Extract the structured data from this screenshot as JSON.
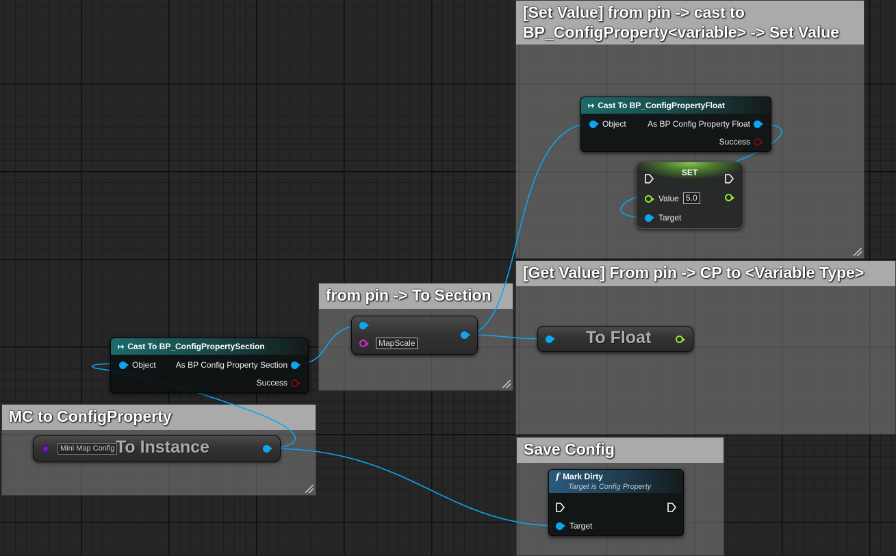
{
  "comments": {
    "set_value": {
      "title_line1": "[Set Value] from pin -> cast to",
      "title_line2": "BP_ConfigProperty<variable> -> Set Value"
    },
    "get_value": {
      "title": "[Get Value] From pin -> CP to <Variable Type>"
    },
    "from_pin": {
      "title": "from pin -> To Section"
    },
    "mc_config": {
      "title": "MC to ConfigProperty"
    },
    "save_config": {
      "title": "Save Config"
    }
  },
  "nodes": {
    "cast_float": {
      "title": "Cast To BP_ConfigPropertyFloat",
      "in_object": "Object",
      "out_as": "As BP Config Property Float",
      "out_success": "Success"
    },
    "set_node": {
      "title": "SET",
      "value_label": "Value",
      "value": "5.0",
      "target_label": "Target"
    },
    "cast_section": {
      "title": "Cast To BP_ConfigPropertySection",
      "in_object": "Object",
      "out_as": "As BP Config Property Section",
      "out_success": "Success"
    },
    "get_section_node": {
      "name_value": "MapScale"
    },
    "to_float": {
      "title": "To Float"
    },
    "to_instance": {
      "title": "To Instance",
      "input_label": "Mini Map Config"
    },
    "mark_dirty": {
      "title": "Mark Dirty",
      "subtitle": "Target is Config Property",
      "target_label": "Target"
    }
  },
  "colors": {
    "object_pin": "#0ca6f0",
    "float_pin": "#9ce62a",
    "name_pin": "#d52bd5",
    "success_pin": "#7a0a0a",
    "wire": "#0ca6f0"
  }
}
